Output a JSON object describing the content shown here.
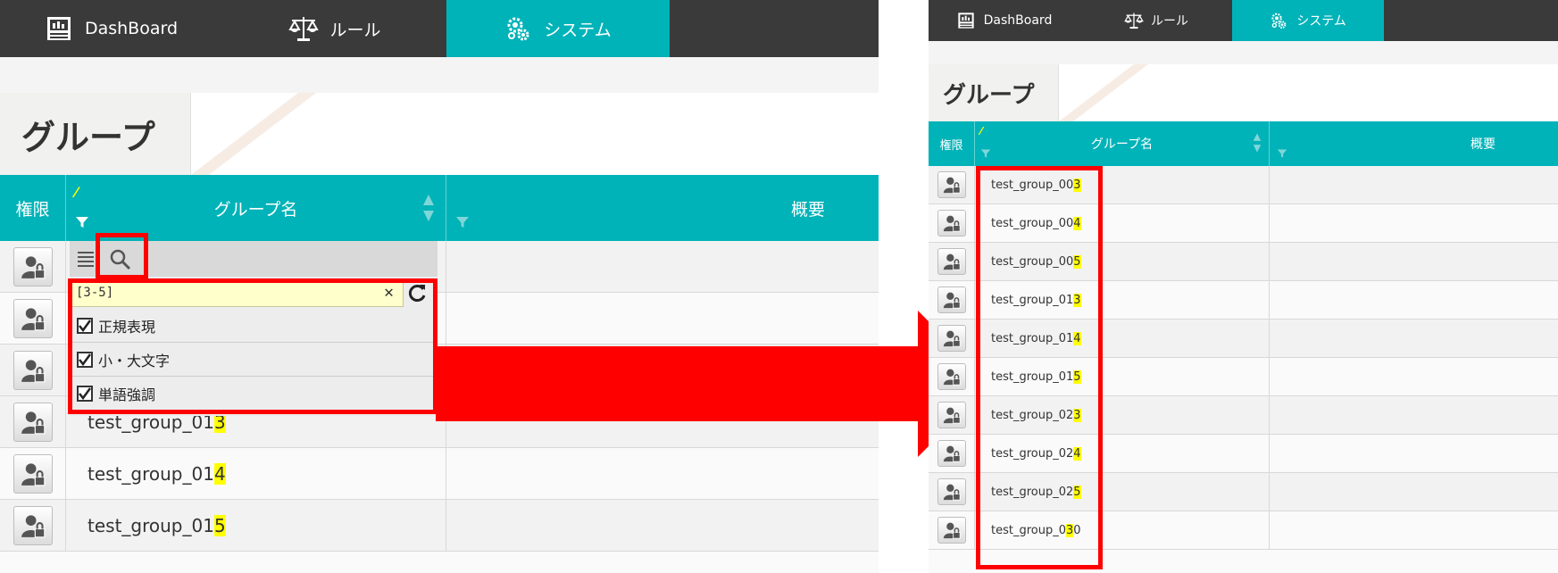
{
  "nav": {
    "tabs": [
      {
        "label": "DashBoard",
        "icon": "dashboard-icon"
      },
      {
        "label": "ルール",
        "icon": "scales-icon"
      },
      {
        "label": "システム",
        "icon": "gears-icon"
      }
    ]
  },
  "page_title": "グループ",
  "table": {
    "headers": {
      "perm": "権限",
      "name": "グループ名",
      "desc": "概要"
    }
  },
  "filter": {
    "value": "[3-5]",
    "clear_icon": "close-icon",
    "refresh_icon": "refresh-icon",
    "options": [
      {
        "label": "正規表現",
        "checked": true
      },
      {
        "label": "小・大文字",
        "checked": true
      },
      {
        "label": "単語強調",
        "checked": true
      }
    ]
  },
  "left_rows": [
    {
      "prefix": "test_group_01",
      "match": "3",
      "suffix": ""
    },
    {
      "prefix": "test_group_01",
      "match": "4",
      "suffix": ""
    },
    {
      "prefix": "test_group_01",
      "match": "5",
      "suffix": ""
    }
  ],
  "right_rows": [
    {
      "prefix": "test_group_00",
      "match": "3",
      "suffix": ""
    },
    {
      "prefix": "test_group_00",
      "match": "4",
      "suffix": ""
    },
    {
      "prefix": "test_group_00",
      "match": "5",
      "suffix": ""
    },
    {
      "prefix": "test_group_01",
      "match": "3",
      "suffix": ""
    },
    {
      "prefix": "test_group_01",
      "match": "4",
      "suffix": ""
    },
    {
      "prefix": "test_group_01",
      "match": "5",
      "suffix": ""
    },
    {
      "prefix": "test_group_02",
      "match": "3",
      "suffix": ""
    },
    {
      "prefix": "test_group_02",
      "match": "4",
      "suffix": ""
    },
    {
      "prefix": "test_group_02",
      "match": "5",
      "suffix": ""
    },
    {
      "prefix": "test_group_0",
      "match": "3",
      "suffix": "0"
    }
  ],
  "colors": {
    "accent": "#00b3b8",
    "nav_bg": "#3a3a3a",
    "highlight": "#ffff00",
    "annotation": "#ff0000"
  }
}
